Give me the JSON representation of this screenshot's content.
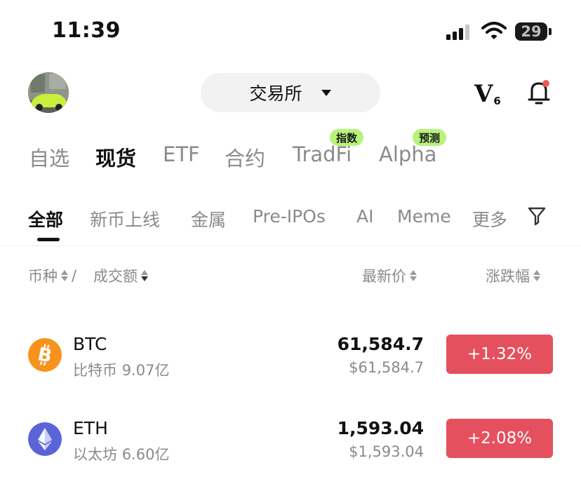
{
  "status_bar": {
    "time": "11:39",
    "battery": "29"
  },
  "header": {
    "exchange_label": "交易所",
    "vip_letter": "V",
    "vip_level": "6"
  },
  "top_tabs": [
    {
      "label": "自选"
    },
    {
      "label": "现货",
      "active": true
    },
    {
      "label": "ETF"
    },
    {
      "label": "合约"
    },
    {
      "label": "TradFi",
      "badge": "指数"
    },
    {
      "label": "Alpha",
      "badge": "预测"
    }
  ],
  "sub_tabs": [
    {
      "label": "全部",
      "active": true
    },
    {
      "label": "新币上线"
    },
    {
      "label": "金属"
    },
    {
      "label": "Pre-IPOs"
    },
    {
      "label": "AI"
    },
    {
      "label": "Meme"
    },
    {
      "label": "更多"
    }
  ],
  "columns": {
    "coin": "币种",
    "separator": "/",
    "volume": "成交额",
    "price": "最新价",
    "change": "涨跌幅"
  },
  "rows": [
    {
      "symbol": "BTC",
      "name": "比特币",
      "volume": "9.07亿",
      "price": "61,584.7",
      "usd": "$61,584.7",
      "change": "+1.32%",
      "icon": "bitcoin-icon",
      "icon_color": "#f7931a"
    },
    {
      "symbol": "ETH",
      "name": "以太坊",
      "volume": "6.60亿",
      "price": "1,593.04",
      "usd": "$1,593.04",
      "change": "+2.08%",
      "icon": "ethereum-icon",
      "icon_color": "#5a64d8"
    }
  ],
  "colors": {
    "up": "#e5505e",
    "badge": "#b8f27a",
    "active_text": "#111111",
    "muted_text": "#8a8a8a"
  }
}
